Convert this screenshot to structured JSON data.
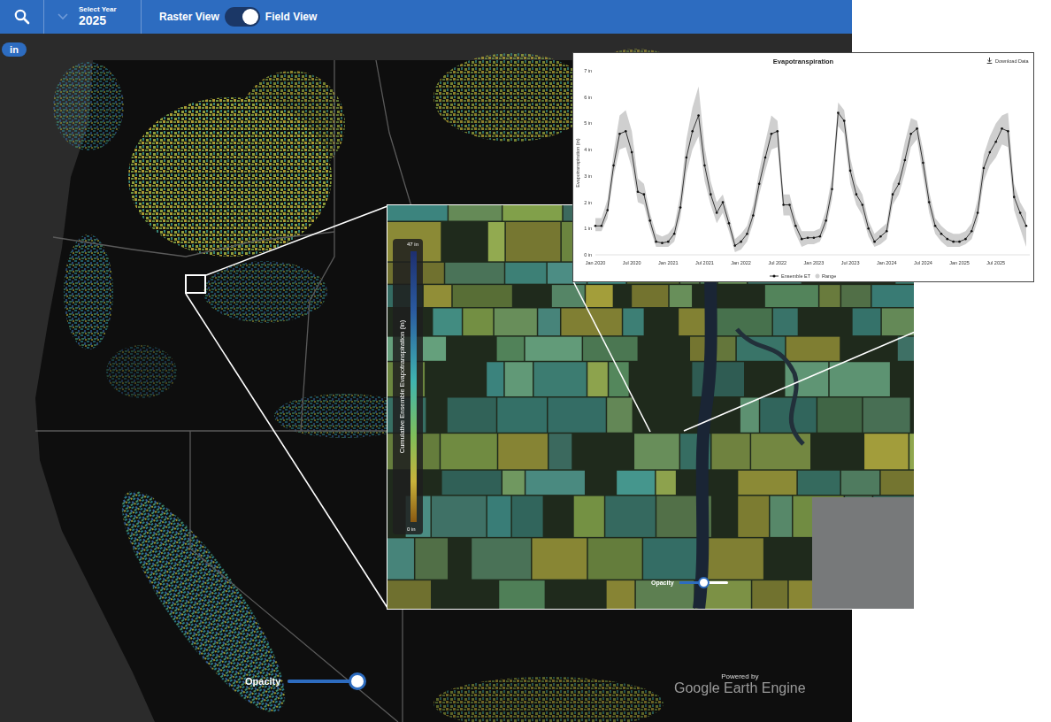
{
  "top_bar": {
    "year_select": {
      "label": "Select Year",
      "value": "2025"
    },
    "view_toggle": {
      "left_label": "Raster View",
      "right_label": "Field View",
      "on": true
    }
  },
  "unit_badge": "in",
  "map": {
    "opacity": {
      "label": "Opacity",
      "level": 1.0
    },
    "attribution": {
      "prefix": "Powered by",
      "name": "Google Earth Engine"
    }
  },
  "inset": {
    "legend": {
      "title": "Cumulative Ensemble Evapotranspiration (in)",
      "max": "47 in",
      "min": "0 in"
    },
    "opacity": {
      "label": "Opacity",
      "level": 0.5
    }
  },
  "chart": {
    "title": "Evapotranspiration",
    "download": "Download Data",
    "y_axis_label": "Evapotranspiration (in)",
    "y_ticks": [
      "0 in",
      "1 in",
      "2 in",
      "3 in",
      "4 in",
      "5 in",
      "6 in",
      "7 in"
    ],
    "x_ticks": [
      "Jan 2020",
      "Jul 2020",
      "Jan 2021",
      "Jul 2021",
      "Jan 2022",
      "Jul 2022",
      "Jan 2023",
      "Jul 2023",
      "Jan 2024",
      "Jul 2024",
      "Jan 2025",
      "Jul 2025"
    ],
    "series": [
      {
        "name": "Ensemble ET",
        "values": [
          1.1,
          1.1,
          1.7,
          3.4,
          4.6,
          4.7,
          3.9,
          2.4,
          2.3,
          1.3,
          0.5,
          0.45,
          0.5,
          0.8,
          1.8,
          3.7,
          4.7,
          5.3,
          3.4,
          2.3,
          1.6,
          2.0,
          1.2,
          0.35,
          0.5,
          0.8,
          1.5,
          2.7,
          3.7,
          4.6,
          4.7,
          1.9,
          1.9,
          1.1,
          0.6,
          0.65,
          0.65,
          0.7,
          1.3,
          2.5,
          5.4,
          5.1,
          3.2,
          2.3,
          1.9,
          1.0,
          0.5,
          0.7,
          0.9,
          2.3,
          2.7,
          3.6,
          4.6,
          4.8,
          3.5,
          2.0,
          1.1,
          0.8,
          0.6,
          0.5,
          0.5,
          0.6,
          0.9,
          1.6,
          3.3,
          3.9,
          4.3,
          4.8,
          4.7,
          2.2,
          1.6,
          1.1
        ]
      }
    ],
    "range": {
      "name": "Range",
      "high": [
        1.4,
        1.4,
        2.1,
        3.9,
        5.3,
        5.5,
        4.7,
        2.9,
        2.7,
        1.6,
        0.8,
        0.7,
        0.8,
        1.1,
        2.3,
        4.4,
        5.6,
        6.4,
        4.1,
        2.8,
        2.0,
        2.3,
        1.5,
        0.6,
        0.8,
        1.1,
        1.9,
        3.2,
        4.3,
        5.3,
        5.1,
        2.3,
        2.3,
        1.4,
        0.9,
        0.9,
        0.9,
        1.0,
        1.7,
        3.0,
        5.8,
        5.5,
        3.7,
        2.7,
        2.3,
        1.3,
        0.8,
        1.0,
        1.2,
        2.7,
        3.2,
        4.3,
        5.2,
        5.1,
        4.0,
        2.4,
        1.4,
        1.1,
        0.9,
        0.8,
        0.8,
        0.9,
        1.2,
        2.1,
        3.8,
        4.5,
        5.0,
        5.3,
        5.4,
        2.7,
        2.0,
        1.6
      ],
      "low": [
        0.9,
        0.9,
        1.4,
        3.0,
        4.0,
        4.1,
        3.3,
        2.0,
        1.9,
        1.0,
        0.3,
        0.3,
        0.3,
        0.5,
        1.4,
        3.1,
        4.0,
        4.5,
        2.8,
        1.9,
        1.2,
        1.6,
        0.9,
        0.1,
        0.2,
        0.5,
        1.2,
        2.3,
        3.2,
        4.0,
        4.1,
        1.5,
        1.5,
        0.8,
        0.3,
        0.4,
        0.4,
        0.5,
        1.0,
        2.1,
        4.9,
        4.6,
        2.7,
        1.9,
        1.5,
        0.7,
        0.3,
        0.4,
        0.6,
        1.9,
        2.3,
        3.1,
        4.1,
        4.4,
        3.0,
        1.6,
        0.8,
        0.5,
        0.3,
        0.3,
        0.3,
        0.4,
        0.6,
        1.3,
        2.8,
        3.4,
        3.7,
        4.2,
        4.1,
        1.7,
        1.0,
        0.3
      ]
    }
  }
}
